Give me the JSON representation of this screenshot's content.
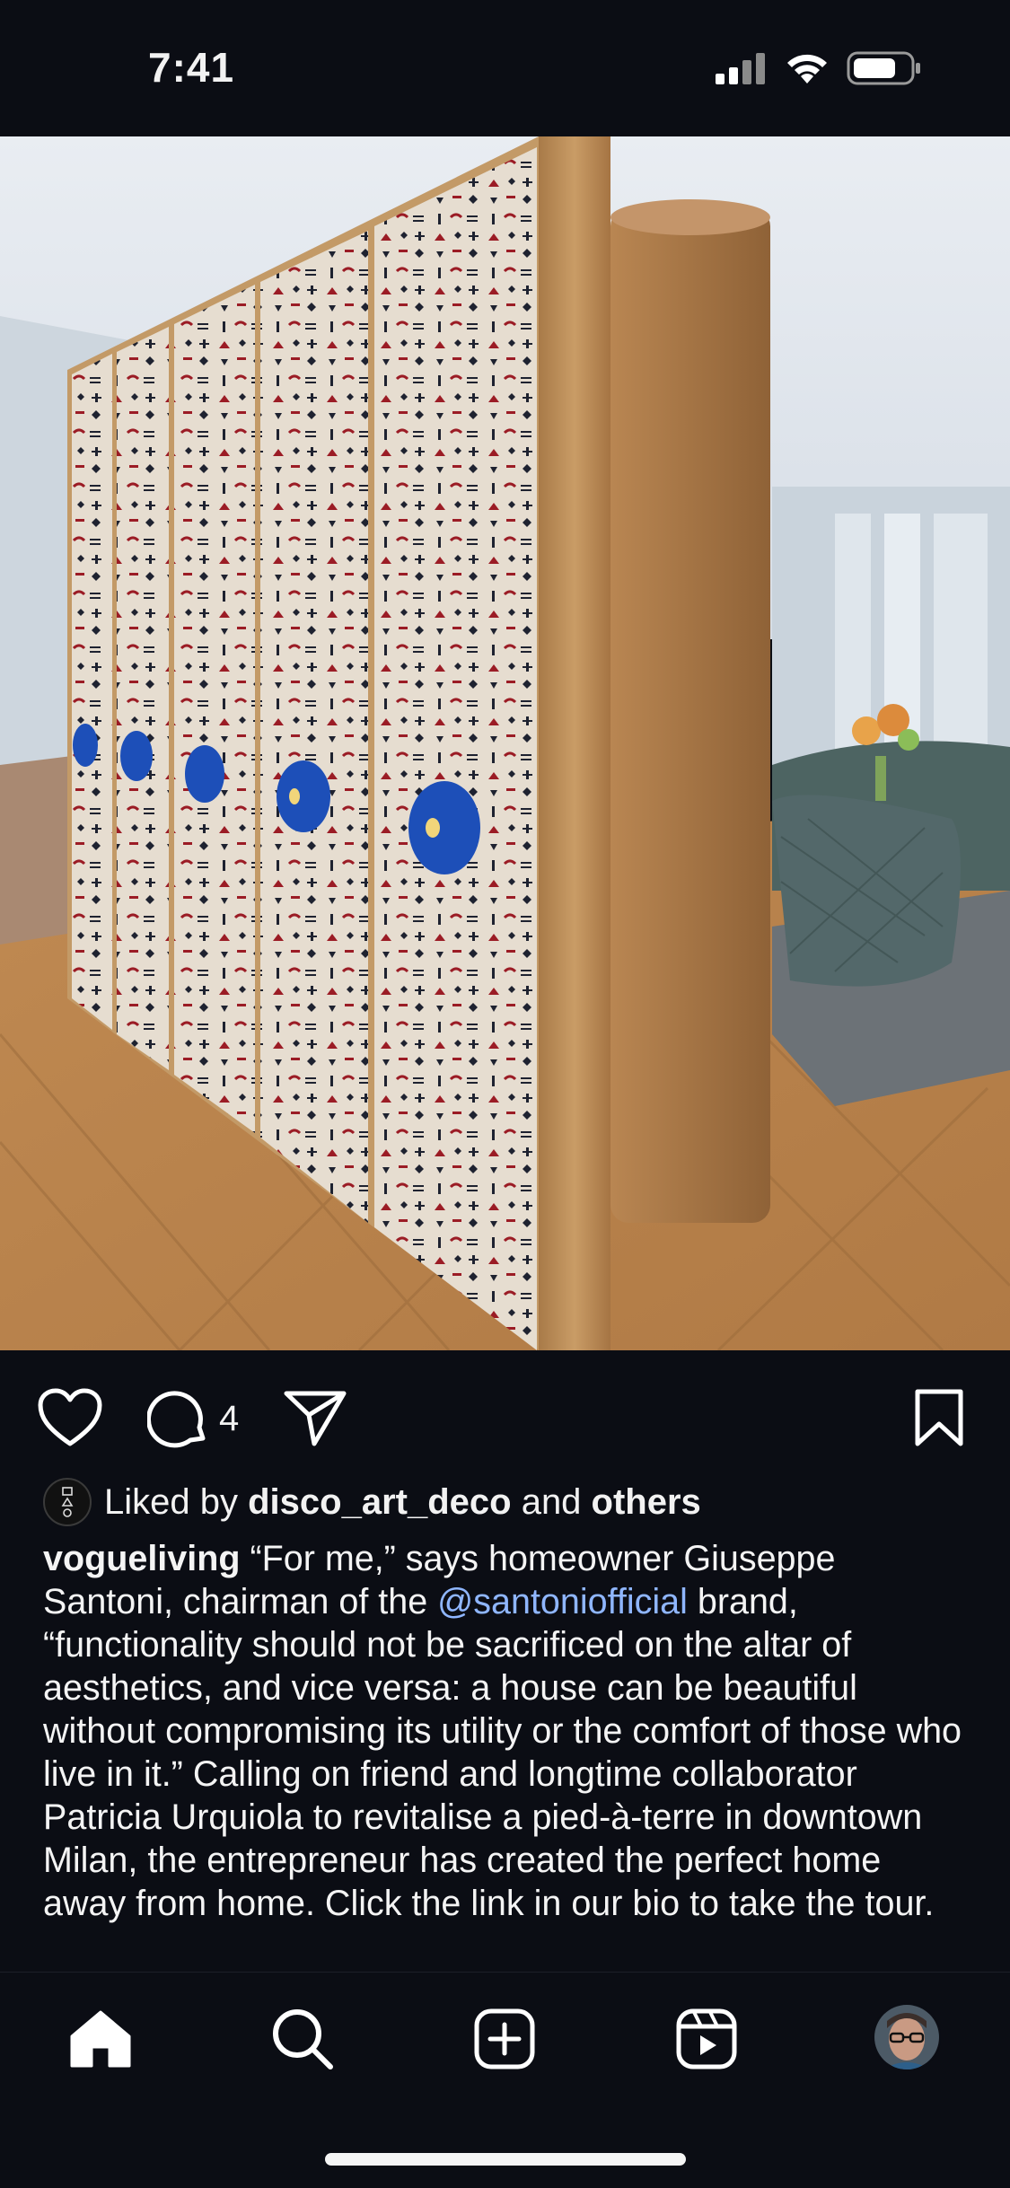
{
  "status_bar": {
    "time": "7:41"
  },
  "post": {
    "comment_count": "4",
    "likes": {
      "prefix": "Liked by ",
      "user": "disco_art_deco",
      "middle": " and ",
      "others": "others"
    },
    "caption": {
      "author": "vogueliving",
      "part1": " “For me,” says homeowner Giuseppe Santoni, chairman of the ",
      "mention": "@santoniofficial",
      "part2": " brand, “functionality should not be sacrificed on the altar of aesthetics, and vice versa: a house can be beautiful without compromising its utility or the comfort of those who live in it.” Calling on friend and longtime collaborator Patricia Urquiola to revitalise a pied-à-terre in downtown Milan, the entrepreneur has created the perfect home away from home. Click the link in our bio to take the tour."
    }
  },
  "nav": {
    "items": [
      "home-icon",
      "search-icon",
      "create-icon",
      "reels-icon",
      "profile-avatar"
    ]
  },
  "colors": {
    "background": "#0b0d14",
    "mention": "#8fb6ff",
    "text": "#f2f2f2"
  }
}
